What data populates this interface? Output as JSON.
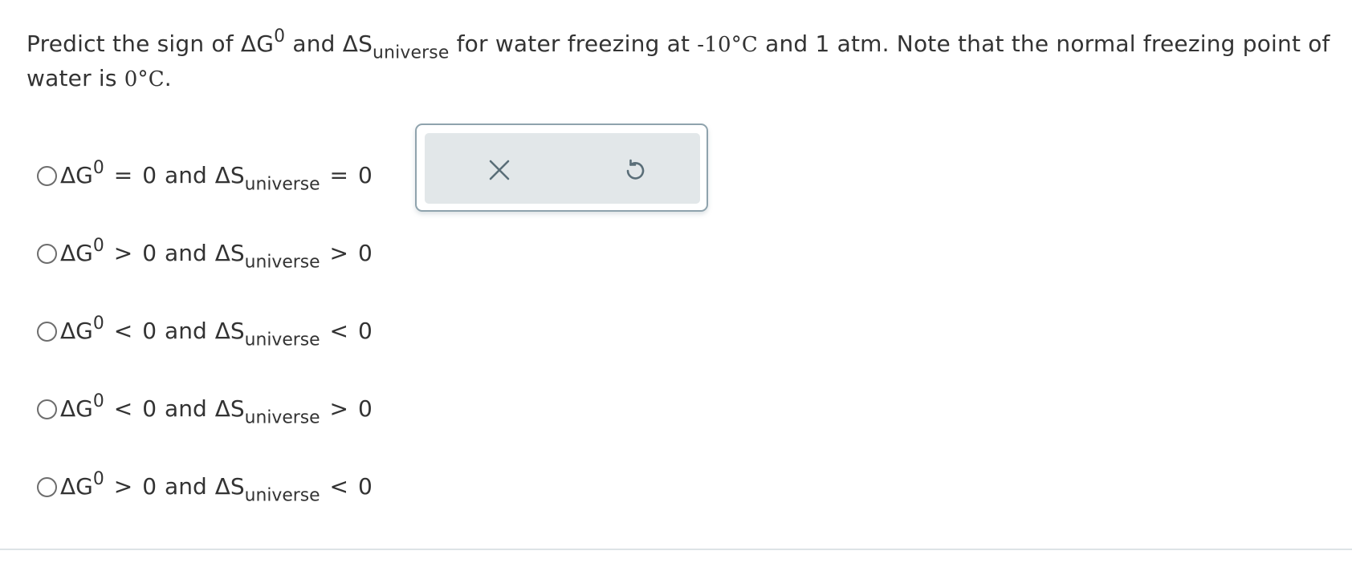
{
  "question": {
    "t1": "Predict the sign of ",
    "dG": "ΔG",
    "dG_sup": "0",
    "t2": " and ",
    "dS": "ΔS",
    "dS_sub": "universe",
    "t3": " for water freezing at ",
    "temp1": "-10°C",
    "t4": " and 1 atm. Note that the normal freezing point of water is ",
    "temp2": "0°C",
    "t5": "."
  },
  "choices": [
    {
      "dG": "ΔG",
      "sup": "0",
      "op1": "=",
      "val1": "0",
      "and": "and",
      "dS": "ΔS",
      "sub": "universe",
      "op2": "=",
      "val2": "0"
    },
    {
      "dG": "ΔG",
      "sup": "0",
      "op1": ">",
      "val1": "0",
      "and": "and",
      "dS": "ΔS",
      "sub": "universe",
      "op2": ">",
      "val2": "0"
    },
    {
      "dG": "ΔG",
      "sup": "0",
      "op1": "<",
      "val1": "0",
      "and": "and",
      "dS": "ΔS",
      "sub": "universe",
      "op2": "<",
      "val2": "0"
    },
    {
      "dG": "ΔG",
      "sup": "0",
      "op1": "<",
      "val1": "0",
      "and": "and",
      "dS": "ΔS",
      "sub": "universe",
      "op2": ">",
      "val2": "0"
    },
    {
      "dG": "ΔG",
      "sup": "0",
      "op1": ">",
      "val1": "0",
      "and": "and",
      "dS": "ΔS",
      "sub": "universe",
      "op2": "<",
      "val2": "0"
    }
  ],
  "toolbar": {
    "clear_icon": "close-icon",
    "undo_icon": "undo-icon",
    "icon_color": "#5a6e78"
  }
}
